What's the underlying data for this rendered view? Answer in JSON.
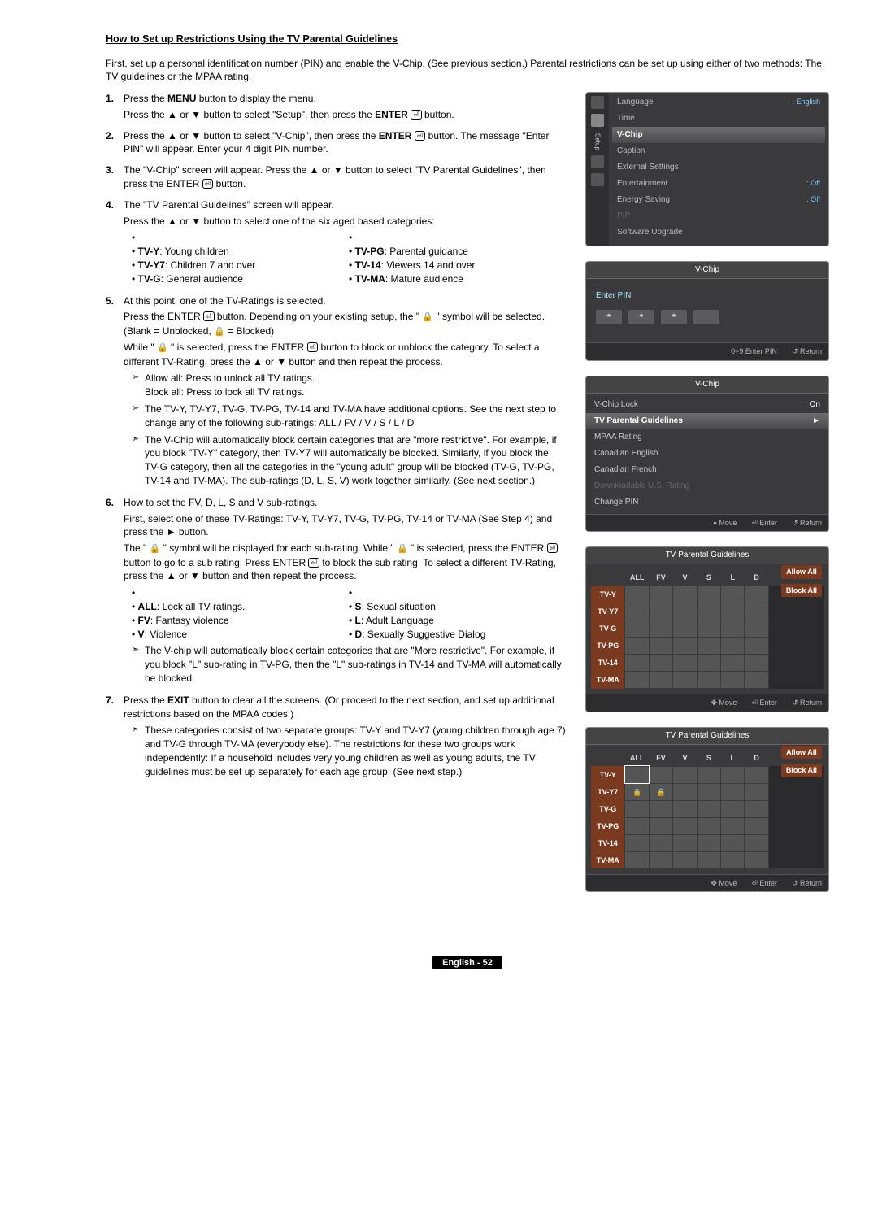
{
  "title": "How to Set up Restrictions Using the TV Parental Guidelines",
  "intro": "First, set up a personal identification number (PIN) and enable the V-Chip. (See previous section.) Parental restrictions can be set up using either of two methods: The TV guidelines or the MPAA rating.",
  "steps": {
    "s1a": "Press the MENU button to display the menu.",
    "s1b_pre": "Press the ▲ or ▼ button to select \"Setup\", then press the ",
    "s1b_post": " button.",
    "s2a_pre": "Press the ▲ or ▼ button to select \"V-Chip\", then press the ",
    "s2a_post": " button. The message \"Enter PIN\" will appear. Enter your 4 digit PIN number.",
    "s3a": "The \"V-Chip\" screen will appear. Press the ▲ or ▼ button to select \"TV Parental Guidelines\", then press the ENTER ",
    "s3a_post": " button.",
    "s4a": "The \"TV Parental Guidelines\" screen will appear.",
    "s4b": "Press the ▲ or ▼ button to select one of the six aged based categories:",
    "ratings": {
      "tvy": "TV-Y: Young children",
      "tvy7": "TV-Y7: Children 7 and over",
      "tvg": "TV-G: General audience",
      "tvpg": "TV-PG: Parental guidance",
      "tv14": "TV-14: Viewers 14 and over",
      "tvma": "TV-MA: Mature audience"
    },
    "s5a": "At this point, one of the TV-Ratings is selected.",
    "s5b_pre": "Press the ENTER ",
    "s5b_mid": " button. Depending on your existing setup, the \" ",
    "s5b_post": " \" symbol will be selected. (Blank = Unblocked, ",
    "s5b_end": " = Blocked)",
    "s5c_pre": "While \" ",
    "s5c_mid": " \" is selected, press the ENTER ",
    "s5c_post": " button to block or unblock the category. To select a different TV-Rating, press the ▲ or ▼ button and then repeat the process.",
    "s5_l1": "Allow all: Press to unlock all TV ratings.\nBlock all: Press to lock all TV ratings.",
    "s5_l2": "The TV-Y, TV-Y7, TV-G, TV-PG, TV-14 and TV-MA have additional options. See the next step to change any of the following sub-ratings: ALL / FV / V / S / L / D",
    "s5_l3": "The V-Chip will automatically block certain categories that are \"more restrictive\". For example, if you block \"TV-Y\" category, then TV-Y7 will automatically be blocked. Similarly, if you block the TV-G category, then all the categories in the \"young adult\" group will be blocked (TV-G, TV-PG, TV-14 and TV-MA). The sub-ratings (D, L, S, V) work together similarly. (See next section.)",
    "s6a": "How to set the FV, D, L, S and V sub-ratings.",
    "s6b": "First, select one of these TV-Ratings: TV-Y, TV-Y7, TV-G, TV-PG, TV-14 or TV-MA (See Step 4) and press the ► button.",
    "s6c_pre": "The \" ",
    "s6c_mid": " \" symbol will be displayed for each sub-rating. While \" ",
    "s6c_mid2": " \" is selected, press the ENTER ",
    "s6c_mid3": " button to go to a sub rating. Press ENTER ",
    "s6c_post": " to block the sub rating. To select a different TV-Rating, press the ▲ or ▼ button and then repeat the process.",
    "subdefs": {
      "all": "ALL: Lock all TV ratings.",
      "fv": "FV: Fantasy violence",
      "v": "V: Violence",
      "s": "S: Sexual situation",
      "l": "L: Adult Language",
      "d": "D: Sexually Suggestive Dialog"
    },
    "s6_l1": "The V-chip will automatically block certain categories that are \"More restrictive\". For example, if you block \"L\" sub-rating in TV-PG, then the \"L\" sub-ratings in TV-14 and TV-MA will automatically be blocked.",
    "s7a": "Press the EXIT button to clear all the screens. (Or proceed to the next section, and set up additional restrictions based on the MPAA codes.)",
    "s7_l1": "These categories consist of two separate groups: TV-Y and TV-Y7 (young children through age 7) and TV-G through TV-MA (everybody else). The restrictions for these two groups work independently: If a household includes very young children as well as young adults, the TV guidelines must be set up separately for each age group. (See next step.)"
  },
  "panels": {
    "setup": {
      "rows": [
        {
          "label": "Language",
          "val": ": English"
        },
        {
          "label": "Time",
          "val": ""
        },
        {
          "label": "V-Chip",
          "val": "",
          "hl": true
        },
        {
          "label": "Caption",
          "val": ""
        },
        {
          "label": "External Settings",
          "val": ""
        },
        {
          "label": "Entertainment",
          "val": ": Off"
        },
        {
          "label": "Energy Saving",
          "val": ": Off"
        },
        {
          "label": "PIP",
          "val": "",
          "dim": true
        },
        {
          "label": "Software Upgrade",
          "val": ""
        }
      ],
      "tab_label": "Setup"
    },
    "pin": {
      "title": "V-Chip",
      "label": "Enter PIN",
      "dots": "*",
      "footer": [
        "0~9 Enter PIN",
        "↺ Return"
      ]
    },
    "vchip": {
      "title": "V-Chip",
      "rows": [
        {
          "label": "V-Chip Lock",
          "val": ": On"
        },
        {
          "label": "TV Parental Guidelines",
          "val": "",
          "hl": true,
          "arrow": "►"
        },
        {
          "label": "MPAA Rating",
          "val": ""
        },
        {
          "label": "Canadian English",
          "val": ""
        },
        {
          "label": "Canadian French",
          "val": ""
        },
        {
          "label": "Downloadable U.S. Rating",
          "val": "",
          "dim": true
        },
        {
          "label": "Change PIN",
          "val": ""
        }
      ],
      "footer": [
        "♦ Move",
        "⏎ Enter",
        "↺ Return"
      ]
    },
    "pg": {
      "title": "TV Parental Guidelines",
      "cols": [
        "ALL",
        "FV",
        "V",
        "S",
        "L",
        "D"
      ],
      "rows": [
        "TV-Y",
        "TV-Y7",
        "TV-G",
        "TV-PG",
        "TV-14",
        "TV-MA"
      ],
      "allow": "Allow All",
      "block": "Block All",
      "footer": [
        "✥ Move",
        "⏎ Enter",
        "↺ Return"
      ]
    }
  },
  "footer": "English - 52"
}
